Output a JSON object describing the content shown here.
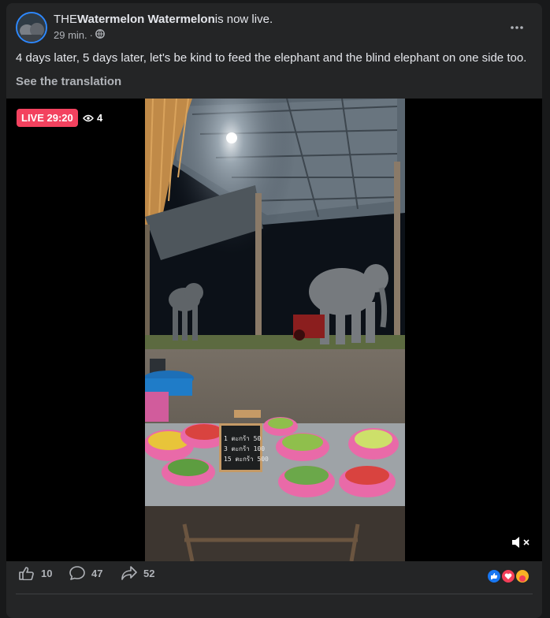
{
  "post": {
    "owner_prefix": "THE",
    "owner_name": "Watermelon Watermelon",
    "status_text": "is now live.",
    "time": "29 min.",
    "separator": "·",
    "audience_icon": "globe-icon",
    "text": "4 days later, 5 days later, let's be kind to feed the elephant and the blind elephant on one side too.",
    "translate_label": "See the translation"
  },
  "video": {
    "live_label": "LIVE 29:20",
    "viewer_count": "4",
    "viewer_icon": "eye-icon",
    "mute_icon": "speaker-muted-icon",
    "sign_lines": [
      "1 ตะกร้า 50",
      "3 ตะกร้า 100",
      "15 ตะกร้า 500"
    ]
  },
  "actions": {
    "like_count": "10",
    "comment_count": "47",
    "share_count": "52",
    "reaction_icons": [
      "like-reaction-icon",
      "love-reaction-icon",
      "care-reaction-icon"
    ]
  },
  "colors": {
    "card_bg": "#242526",
    "live_red": "#f3425f",
    "link_blue": "#2d88ff",
    "muted_text": "#b0b3b8"
  }
}
